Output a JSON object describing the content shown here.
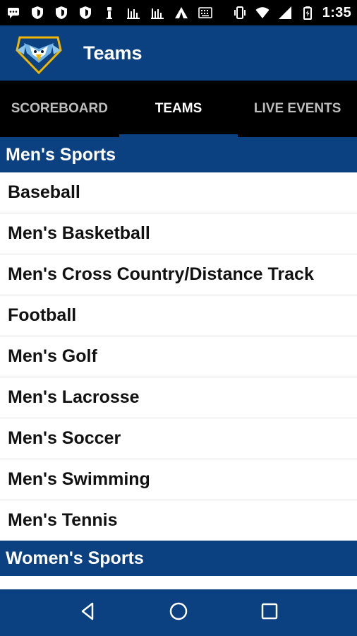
{
  "status_bar": {
    "time": "1:35",
    "icons": [
      "chat-icon",
      "shield-icon",
      "shield-icon",
      "shield-icon",
      "figure-icon",
      "bar-chart-icon",
      "bar-chart-icon",
      "tent-icon",
      "keyboard-icon",
      "vibrate-icon",
      "wifi-icon",
      "signal-icon",
      "battery-icon"
    ]
  },
  "app_bar": {
    "title": "Teams",
    "logo": "eagle-logo"
  },
  "tabs": [
    {
      "label": "SCOREBOARD",
      "active": false
    },
    {
      "label": "TEAMS",
      "active": true
    },
    {
      "label": "LIVE EVENTS",
      "active": false
    }
  ],
  "sections": {
    "mens": {
      "title": "Men's Sports",
      "items": [
        "Baseball",
        "Men's Basketball",
        "Men's Cross Country/Distance Track",
        "Football",
        "Men's Golf",
        "Men's Lacrosse",
        "Men's Soccer",
        "Men's Swimming",
        "Men's Tennis"
      ]
    },
    "womens": {
      "title": "Women's Sports"
    }
  },
  "nav_bar": {
    "buttons": [
      "back-icon",
      "home-icon",
      "recents-icon"
    ]
  },
  "colors": {
    "brand_blue": "#0b4180",
    "tab_bg": "#000000",
    "gold": "#f2b600"
  }
}
